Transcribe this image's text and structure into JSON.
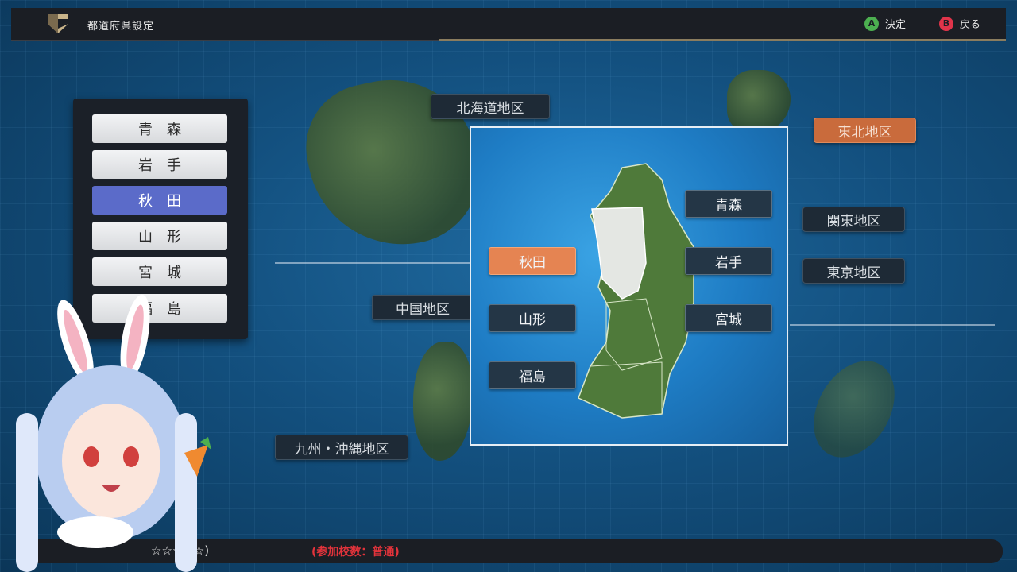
{
  "header": {
    "title": "都道府県設定",
    "confirm_key": "A",
    "confirm_label": "決定",
    "back_key": "B",
    "back_label": "戻る"
  },
  "regions": [
    {
      "label": "北海道地区",
      "active": false
    },
    {
      "label": "東北地区",
      "active": true
    },
    {
      "label": "関東地区",
      "active": false
    },
    {
      "label": "東京地区",
      "active": false
    },
    {
      "label": "中国地区",
      "active": false
    },
    {
      "label": "九州・沖縄地区",
      "active": false
    }
  ],
  "prefecture_list": [
    {
      "label": "青森",
      "selected": false
    },
    {
      "label": "岩手",
      "selected": false
    },
    {
      "label": "秋田",
      "selected": true
    },
    {
      "label": "山形",
      "selected": false
    },
    {
      "label": "宮城",
      "selected": false
    },
    {
      "label": "福島",
      "selected": false
    }
  ],
  "map_labels": {
    "aomori": "青森",
    "iwate": "岩手",
    "akita": "秋田",
    "yamagata": "山形",
    "miyagi": "宮城",
    "fukushima": "福島"
  },
  "footer": {
    "stars": "☆☆☆☆☆)",
    "schools": "(参加校数：普通)"
  },
  "colors": {
    "active_region": "#c96b3c",
    "selected_item": "#5b6bc9",
    "map_active": "#e58452"
  }
}
